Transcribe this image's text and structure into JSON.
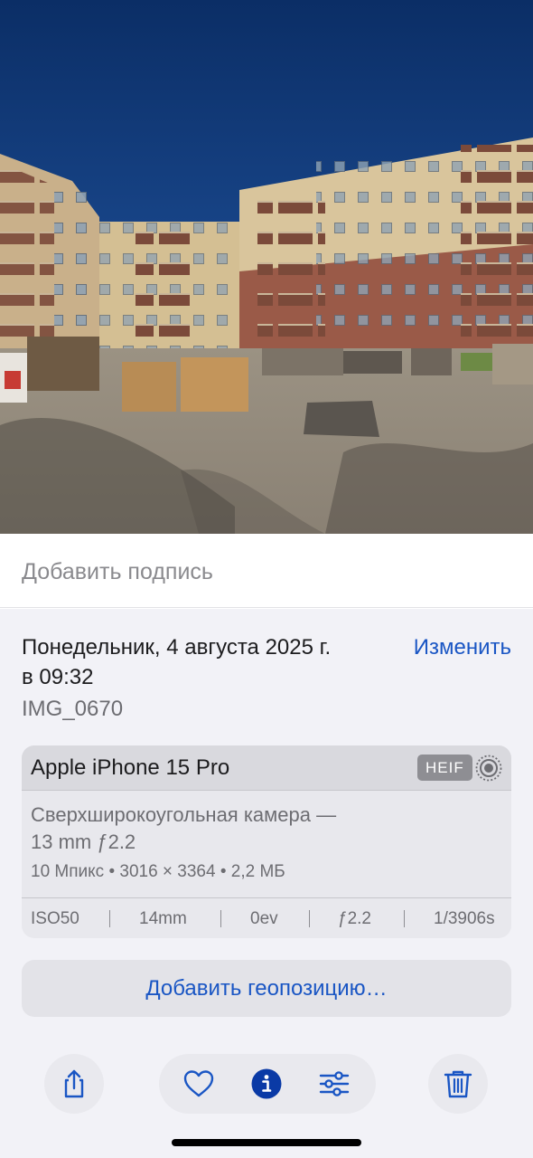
{
  "caption": {
    "placeholder": "Добавить подпись"
  },
  "info": {
    "date_line1": "Понедельник, 4 августа 2025 г.",
    "date_line2": "в 09:32",
    "edit_label": "Изменить",
    "filename": "IMG_0670"
  },
  "exif": {
    "device": "Apple iPhone 15 Pro",
    "format_badge": "HEIF",
    "lens_line1": "Сверхширокоугольная камера —",
    "lens_line2": "13 mm ƒ2.2",
    "specs": "10 Мпикс • 3016 × 3364 • 2,2 МБ",
    "iso": "ISO50",
    "focal": "14mm",
    "exposure_bias": "0ev",
    "aperture": "ƒ2.2",
    "shutter": "1/3906s"
  },
  "geo": {
    "label": "Добавить геопозицию…"
  },
  "toolbar": {
    "icons": [
      "share-icon",
      "heart-icon",
      "info-icon",
      "adjust-icon",
      "trash-icon"
    ]
  },
  "colors": {
    "accent": "#1a56c4",
    "info_active": "#0a3aa6",
    "panel_bg": "#f2f2f7",
    "card_bg": "#e8e8ed",
    "badge_bg": "#8e8e93"
  }
}
